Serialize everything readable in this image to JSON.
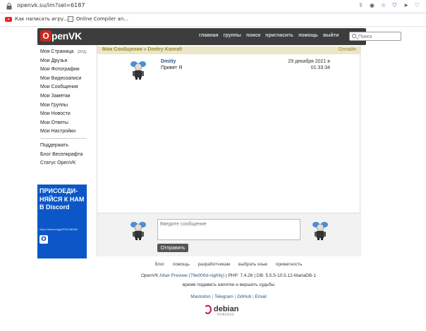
{
  "browser": {
    "url": "openvk.su/im?sel=6187",
    "bookmarks": [
      {
        "label": "Как написать игру..."
      },
      {
        "label": "Online Compiler an..."
      }
    ]
  },
  "site": {
    "logo_letter": "O",
    "logo_text": "penVK",
    "nav": [
      "главная",
      "группы",
      "поиск",
      "пригласить",
      "помощь",
      "выйти"
    ],
    "search_placeholder": "Поиск"
  },
  "sidebar": {
    "items": [
      {
        "label": "Моя Страница",
        "extra": "ред."
      },
      {
        "label": "Мои Друзья"
      },
      {
        "label": "Мои Фотографии"
      },
      {
        "label": "Мои Видеозаписи"
      },
      {
        "label": "Мои Сообщения"
      },
      {
        "label": "Мои Заметки"
      },
      {
        "label": "Мои Группы"
      },
      {
        "label": "Мои Новости"
      },
      {
        "label": "Мои Ответы"
      },
      {
        "label": "Мои Настройки"
      }
    ],
    "secondary": [
      {
        "label": "Поддержать"
      },
      {
        "label": "Блог Веселкрафта"
      },
      {
        "label": "Статус OpenVK"
      }
    ],
    "discord": {
      "title": "ПРИСОЕДИ-НЯЙСЯ К НАМ В Discord",
      "link": "https://discord.gg/5T5oTaRs5k"
    }
  },
  "conversation": {
    "breadcrumb_section": "Мои Сообщения",
    "breadcrumb_sep": "»",
    "breadcrumb_name": "Dmitry Konrafi",
    "status": "Онлайн",
    "messages": [
      {
        "author": "Dmitiy",
        "text": "Привет Я",
        "date": "29 декабря 2021 в 01:33:34"
      }
    ],
    "compose_placeholder": "Введите сообщение",
    "send_label": "Отправить"
  },
  "footer": {
    "links": [
      "блог",
      "помощь",
      "разработчикам",
      "выбрать язык",
      "приватность"
    ],
    "version_prefix": "OpenVK",
    "version_accent": "Altair Preview (79e000d-nightly)",
    "version_suffix": "| PHP: 7.4.26 | DB: 5.5.5-10.5.12-MariaDB-1",
    "slogan": "время подавать напитки и вершить судьбы",
    "social": [
      "Mastodon",
      "Telegram",
      "GitHub",
      "Email"
    ],
    "debian_text": "debian",
    "debian_sub": "POWERED"
  },
  "colors": {
    "header_bg": "#3d3d3d",
    "accent_link": "#2a5885",
    "crumb_bg": "#ece7c6",
    "discord_bg": "#0b57c7",
    "logo_red": "#c8281e"
  }
}
